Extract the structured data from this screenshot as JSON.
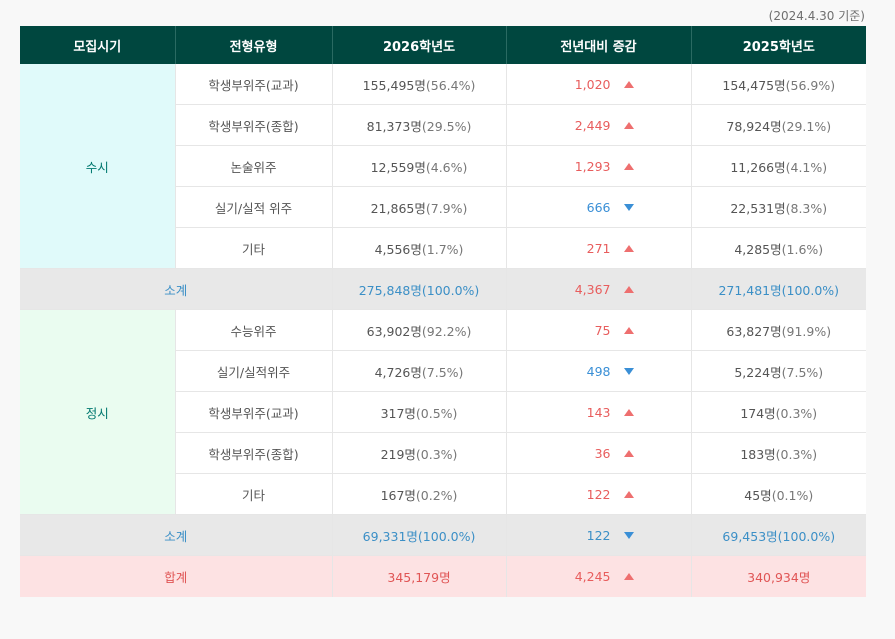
{
  "note": "(2024.4.30 기준)",
  "headers": [
    "모집시기",
    "전형유형",
    "2026학년도",
    "전년대비 증감",
    "2025학년도"
  ],
  "susi": {
    "label": "수시",
    "rows": [
      {
        "type": "학생부위주(교과)",
        "y2026": "155,495명",
        "y2026_pct": "(56.4%)",
        "diff": "1,020",
        "dir": "up",
        "y2025": "154,475명",
        "y2025_pct": "(56.9%)"
      },
      {
        "type": "학생부위주(종합)",
        "y2026": "81,373명",
        "y2026_pct": "(29.5%)",
        "diff": "2,449",
        "dir": "up",
        "y2025": "78,924명",
        "y2025_pct": "(29.1%)"
      },
      {
        "type": "논술위주",
        "y2026": "12,559명",
        "y2026_pct": "(4.6%)",
        "diff": "1,293",
        "dir": "up",
        "y2025": "11,266명",
        "y2025_pct": "(4.1%)"
      },
      {
        "type": "실기/실적 위주",
        "y2026": "21,865명",
        "y2026_pct": "(7.9%)",
        "diff": "666",
        "dir": "down",
        "y2025": "22,531명",
        "y2025_pct": "(8.3%)"
      },
      {
        "type": "기타",
        "y2026": "4,556명",
        "y2026_pct": "(1.7%)",
        "diff": "271",
        "dir": "up",
        "y2025": "4,285명",
        "y2025_pct": "(1.6%)"
      }
    ],
    "subtotal": {
      "label": "소계",
      "y2026": "275,848명(100.0%)",
      "diff": "4,367",
      "dir": "up",
      "y2025": "271,481명(100.0%)"
    }
  },
  "jeongsi": {
    "label": "정시",
    "rows": [
      {
        "type": "수능위주",
        "y2026": "63,902명",
        "y2026_pct": "(92.2%)",
        "diff": "75",
        "dir": "up",
        "y2025": "63,827명",
        "y2025_pct": "(91.9%)"
      },
      {
        "type": "실기/실적위주",
        "y2026": "4,726명",
        "y2026_pct": "(7.5%)",
        "diff": "498",
        "dir": "down",
        "y2025": "5,224명",
        "y2025_pct": "(7.5%)"
      },
      {
        "type": "학생부위주(교과)",
        "y2026": "317명",
        "y2026_pct": "(0.5%)",
        "diff": "143",
        "dir": "up",
        "y2025": "174명",
        "y2025_pct": "(0.3%)"
      },
      {
        "type": "학생부위주(종합)",
        "y2026": "219명",
        "y2026_pct": "(0.3%)",
        "diff": "36",
        "dir": "up",
        "y2025": "183명",
        "y2025_pct": "(0.3%)"
      },
      {
        "type": "기타",
        "y2026": "167명",
        "y2026_pct": "(0.2%)",
        "diff": "122",
        "dir": "up",
        "y2025": "45명",
        "y2025_pct": "(0.1%)"
      }
    ],
    "subtotal": {
      "label": "소계",
      "y2026": "69,331명(100.0%)",
      "diff": "122",
      "dir": "down",
      "y2025": "69,453명(100.0%)"
    }
  },
  "total": {
    "label": "합계",
    "y2026": "345,179명",
    "diff": "4,245",
    "dir": "up",
    "y2025": "340,934명"
  },
  "colors": {
    "header_bg": "#00473f",
    "susi_bg": "#e0fafa",
    "jeongsi_bg": "#eafcf0",
    "subtotal_bg": "#e8e8e8",
    "total_bg": "#fde2e3",
    "increase": "#e85d5d",
    "decrease": "#3a8fd6"
  }
}
